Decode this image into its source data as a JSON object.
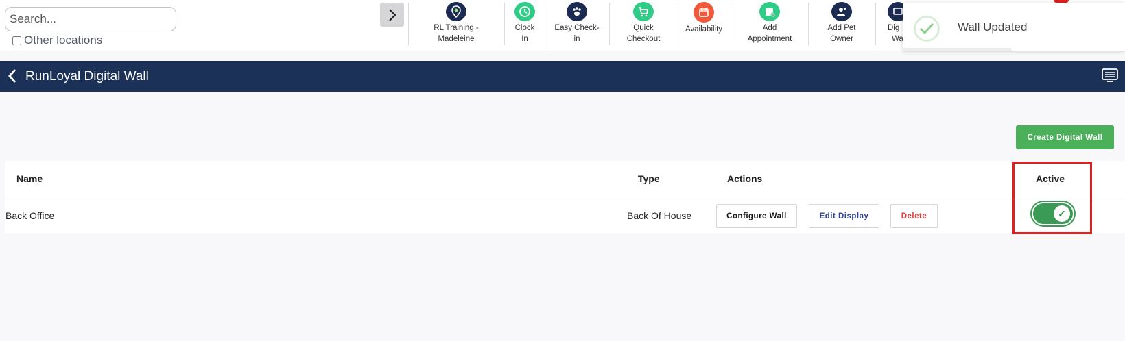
{
  "search": {
    "placeholder": "Search..."
  },
  "other_locations": {
    "label": "Other locations",
    "checked": false
  },
  "quick_actions": [
    {
      "line1": "RL Training -",
      "line2": "Madeleine",
      "icon": "location-pin-icon",
      "color": "#1b2b52"
    },
    {
      "line1": "Clock",
      "line2": "In",
      "icon": "clock-icon",
      "color": "#2ecc86"
    },
    {
      "line1": "Easy Check-",
      "line2": "in",
      "icon": "paw-icon",
      "color": "#1b2b52"
    },
    {
      "line1": "Quick",
      "line2": "Checkout",
      "icon": "cart-icon",
      "color": "#2ecc86"
    },
    {
      "line1": "Availability",
      "line2": "",
      "icon": "calendar-icon",
      "color": "#f05a3a"
    },
    {
      "line1": "Add",
      "line2": "Appointment",
      "icon": "calendar-plus-icon",
      "color": "#2ecc86"
    },
    {
      "line1": "Add Pet",
      "line2": "Owner",
      "icon": "add-user-icon",
      "color": "#1b2b52"
    },
    {
      "line1": "Dig",
      "line2": "Wa",
      "icon": "display-icon",
      "color": "#1b2b52"
    }
  ],
  "toast": {
    "message": "Wall Updated"
  },
  "header": {
    "title": "RunLoyal Digital Wall"
  },
  "create_button": {
    "label": "Create Digital Wall"
  },
  "table": {
    "columns": [
      "Name",
      "Type",
      "Actions",
      "Active"
    ],
    "rows": [
      {
        "name": "Back Office",
        "type": "Back Of House",
        "active": true
      }
    ],
    "actions": {
      "configure": "Configure Wall",
      "edit": "Edit Display",
      "delete": "Delete"
    }
  },
  "colors": {
    "header_bg": "#1b3158",
    "create_button": "#4caf5a",
    "toggle_on": "#3a9b56",
    "delete_text": "#e03a3a",
    "edit_text": "#2a3f9c",
    "highlight": "#e0201f"
  }
}
